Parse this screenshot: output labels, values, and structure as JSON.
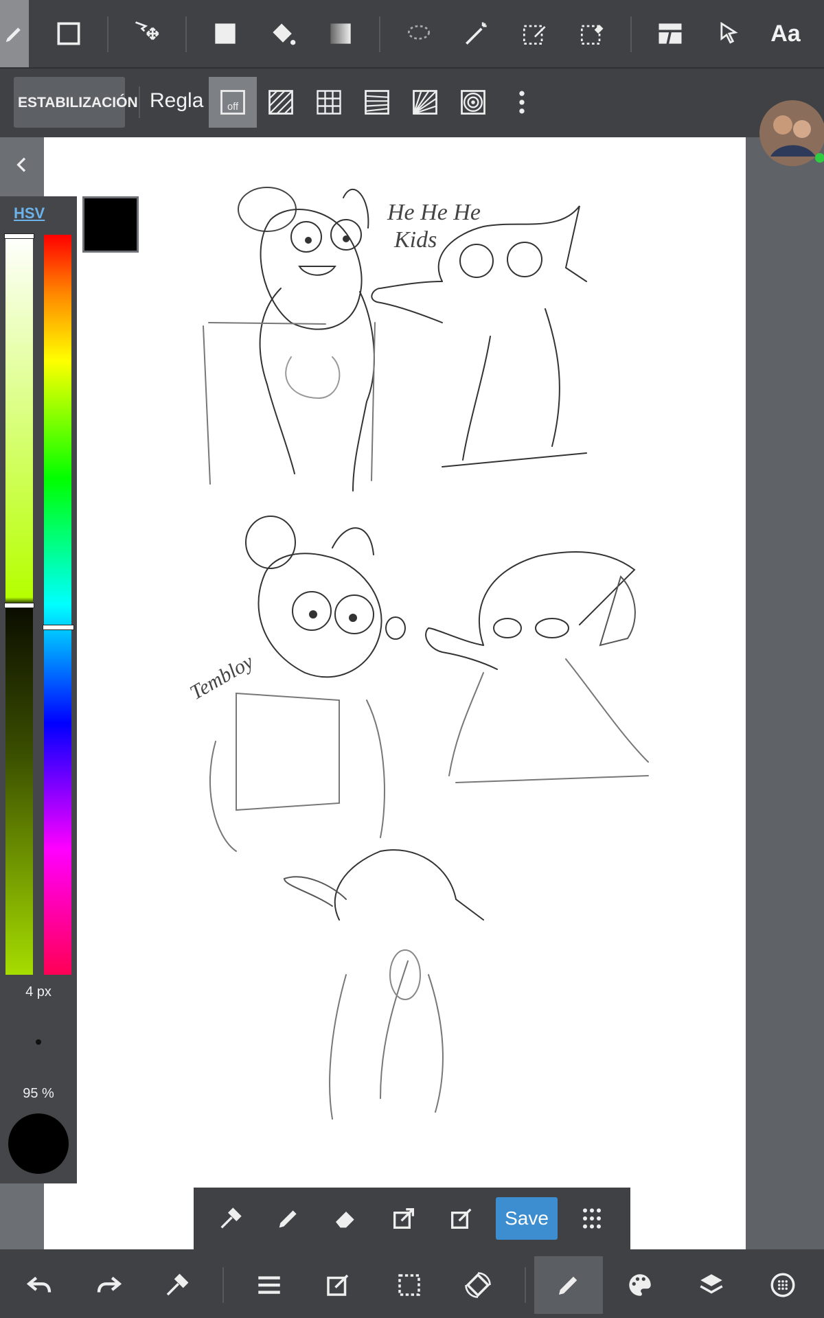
{
  "toolbar": {
    "tools": [
      "pen-icon",
      "rectangle-select-icon",
      "move-icon",
      "fill-rect-icon",
      "bucket-icon",
      "gradient-icon",
      "lasso-icon",
      "magic-wand-icon",
      "select-pen-icon",
      "select-eraser-icon",
      "frame-divider-icon",
      "pointer-icon"
    ],
    "text_tool": "Aa"
  },
  "stabilizer": {
    "label": "ESTABILIZACIÓN"
  },
  "ruler": {
    "label": "Regla",
    "off_text": "off"
  },
  "color_panel": {
    "tab": "HSV",
    "brush_size": "4 px",
    "opacity": "95 %",
    "current_color": "#000000",
    "hue_marker_fraction": 0.53,
    "sv_marker_fraction": 0.5
  },
  "quick_bar": {
    "save_label": "Save"
  },
  "colors": {
    "accent": "#3d8ed0",
    "toolbar": "#3f4144",
    "hsv_tab": "#6cb3ea"
  }
}
